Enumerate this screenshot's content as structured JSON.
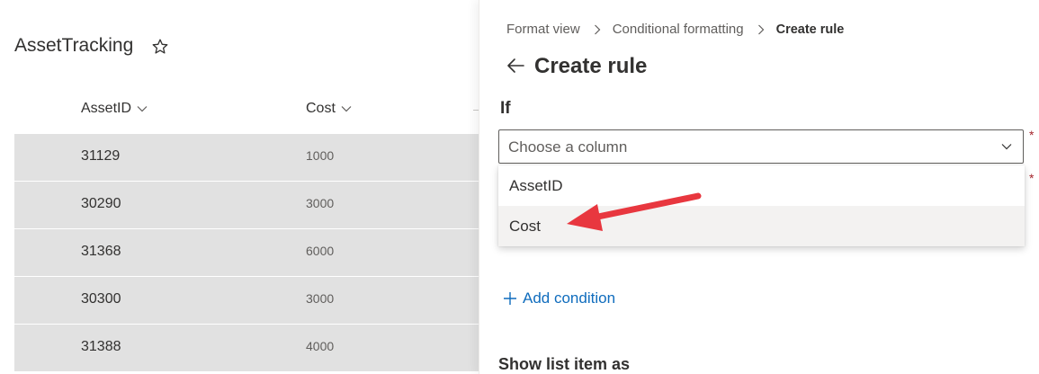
{
  "list": {
    "title": "AssetTracking",
    "columns": [
      {
        "label": "AssetID"
      },
      {
        "label": "Cost"
      }
    ],
    "rows": [
      {
        "asset_id": "31129",
        "cost": "1000"
      },
      {
        "asset_id": "30290",
        "cost": "3000"
      },
      {
        "asset_id": "31368",
        "cost": "6000"
      },
      {
        "asset_id": "30300",
        "cost": "3000"
      },
      {
        "asset_id": "31388",
        "cost": "4000"
      }
    ]
  },
  "panel": {
    "breadcrumb": [
      "Format view",
      "Conditional formatting",
      "Create rule"
    ],
    "title": "Create rule",
    "if_label": "If",
    "required_marker": "*",
    "column_select": {
      "placeholder": "Choose a column",
      "options": [
        "AssetID",
        "Cost"
      ],
      "highlighted_option": "Cost"
    },
    "add_condition": "Add condition",
    "show_list_item_as": "Show list item as"
  },
  "colors": {
    "accent": "#0f6cbd",
    "annotation_arrow": "#e8373f",
    "row_background": "#e1e1e1",
    "required": "#a4262c"
  },
  "icons": {
    "favorite": "star-outline-icon",
    "back": "arrow-left-icon",
    "dropdown": "chevron-down-icon",
    "add": "plus-icon",
    "breadcrumb_separator": "chevron-right-icon"
  }
}
